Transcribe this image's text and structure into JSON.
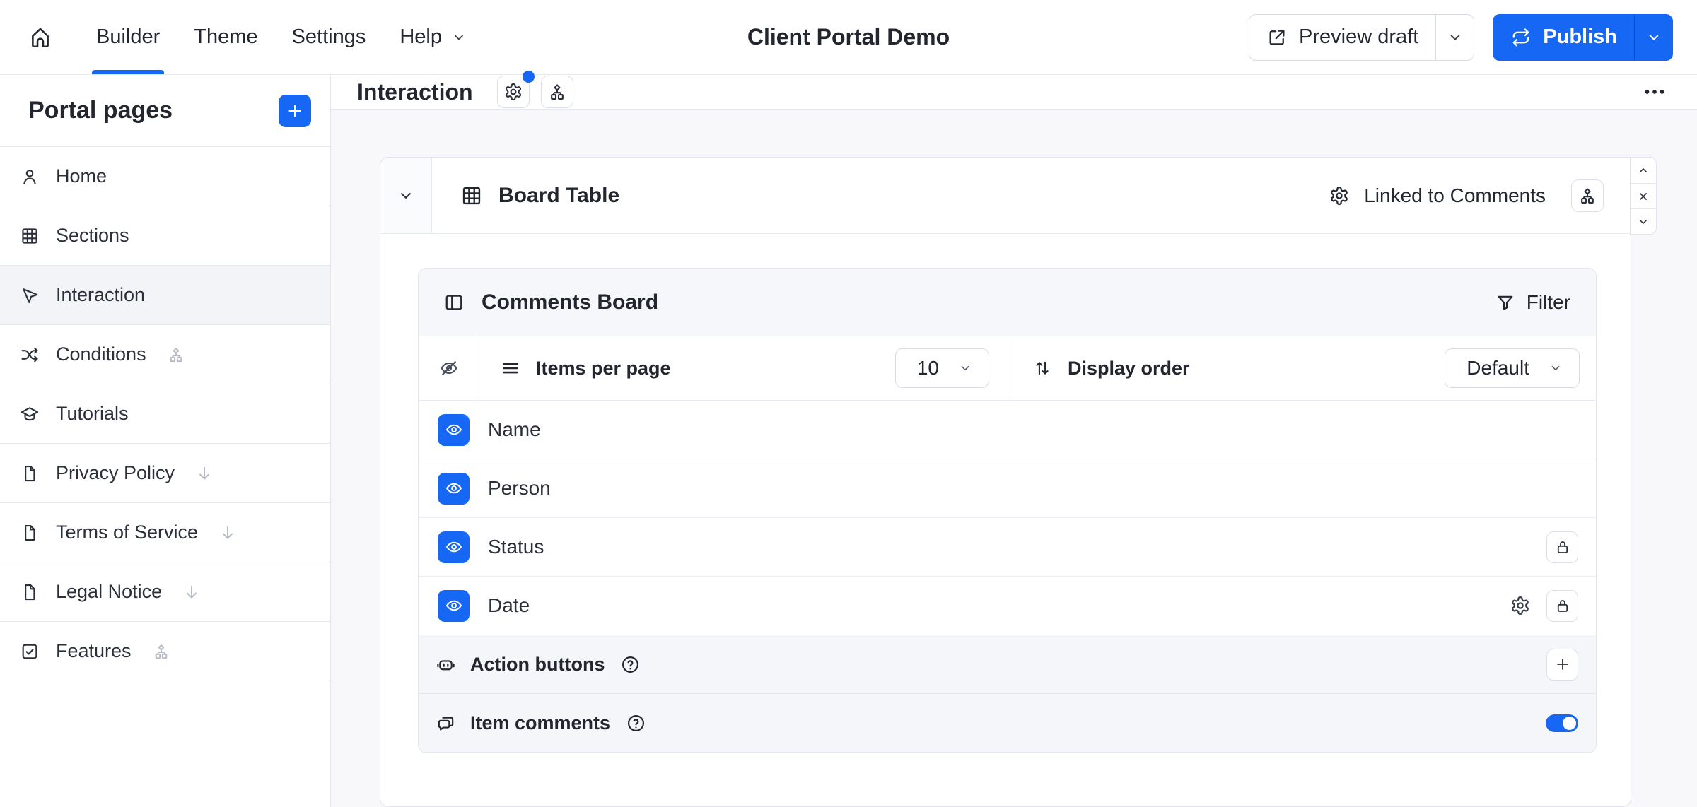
{
  "colors": {
    "accent": "#1667f3",
    "canvas": "#f8f8fb",
    "panel_header": "#f6f7fa"
  },
  "topbar": {
    "home_icon": "home-icon",
    "nav": [
      {
        "label": "Builder",
        "active": true
      },
      {
        "label": "Theme",
        "active": false
      },
      {
        "label": "Settings",
        "active": false
      },
      {
        "label": "Help",
        "active": false,
        "dropdown_icon": "chevron-down-icon"
      }
    ],
    "title": "Client Portal Demo",
    "preview_button": {
      "label": "Preview draft",
      "icon": "external-link-icon",
      "chevron_icon": "chevron-down-icon"
    },
    "publish_button": {
      "label": "Publish",
      "icon": "publish-icon",
      "chevron_icon": "chevron-down-icon"
    }
  },
  "sidebar": {
    "heading": "Portal pages",
    "add_button_icon": "plus-icon",
    "items": [
      {
        "label": "Home",
        "icon": "user-icon"
      },
      {
        "label": "Sections",
        "icon": "grid-icon"
      },
      {
        "label": "Interaction",
        "icon": "cursor-icon",
        "selected": true
      },
      {
        "label": "Conditions",
        "icon": "shuffle-icon",
        "trailing_icon": "sitemap-icon"
      },
      {
        "label": "Tutorials",
        "icon": "graduation-cap-icon"
      },
      {
        "label": "Privacy Policy",
        "icon": "file-icon",
        "trailing_icon": "arrow-down-icon"
      },
      {
        "label": "Terms of Service",
        "icon": "file-icon",
        "trailing_icon": "arrow-down-icon"
      },
      {
        "label": "Legal Notice",
        "icon": "file-icon",
        "trailing_icon": "arrow-down-icon"
      },
      {
        "label": "Features",
        "icon": "checkbox-icon",
        "trailing_icon": "sitemap-icon"
      }
    ]
  },
  "page_header": {
    "title": "Interaction",
    "settings_action": {
      "icon": "gear-icon",
      "badge": true
    },
    "visibility_action": {
      "icon": "sitemap-icon"
    },
    "menu_icon": "ellipsis-icon"
  },
  "block": {
    "collapse_icon": "chevron-down-icon",
    "icon": "table-icon",
    "title": "Board Table",
    "linked": {
      "icon": "gear-icon",
      "label": "Linked to Comments"
    },
    "link_button_icon": "sitemap-icon",
    "controls": {
      "up_icon": "chevron-up-icon",
      "close_icon": "close-icon",
      "down_icon": "chevron-down-icon"
    }
  },
  "panel": {
    "icon": "panel-left-icon",
    "title": "Comments Board",
    "filter": {
      "icon": "funnel-icon",
      "label": "Filter"
    },
    "settings_row": {
      "hidden_icon": "eye-off-icon",
      "items_per_page": {
        "icon": "menu-icon",
        "label": "Items per page",
        "value": "10",
        "chevron_icon": "chevron-down-icon"
      },
      "display_order": {
        "icon": "sort-icon",
        "label": "Display order",
        "value": "Default",
        "chevron_icon": "chevron-down-icon"
      }
    },
    "row_icons": {
      "eye": "eye-icon",
      "lock": "lock-icon",
      "gear": "gear-icon"
    },
    "fields": [
      {
        "label": "Name",
        "visible": true
      },
      {
        "label": "Person",
        "visible": true
      },
      {
        "label": "Status",
        "visible": true,
        "lock": true
      },
      {
        "label": "Date",
        "visible": true,
        "gear": true,
        "lock": true
      }
    ],
    "action_buttons": {
      "icon": "robot-icon",
      "label": "Action buttons",
      "help_icon": "help-icon",
      "add_icon": "plus-icon"
    },
    "item_comments": {
      "icon": "comments-icon",
      "label": "Item comments",
      "help_icon": "help-icon",
      "toggle_on": true
    }
  }
}
